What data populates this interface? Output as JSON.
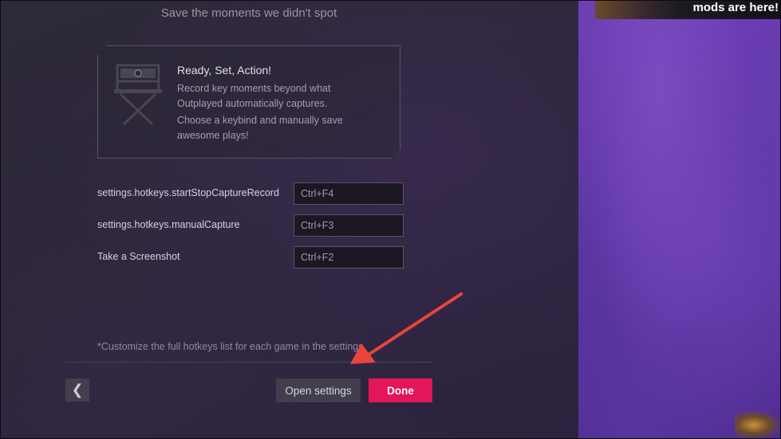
{
  "header": {
    "subtitle": "Save the moments we didn't spot"
  },
  "card": {
    "icon": "director-chair-icon",
    "title": "Ready, Set, Action!",
    "line1": "Record key moments beyond what",
    "line2": "Outplayed automatically captures.",
    "line3": "Choose a keybind and manually save",
    "line4": "awesome plays!"
  },
  "hotkeys": [
    {
      "label": "settings.hotkeys.startStopCaptureRecord",
      "value": "Ctrl+F4"
    },
    {
      "label": "settings.hotkeys.manualCapture",
      "value": "Ctrl+F3"
    },
    {
      "label": "Take a Screenshot",
      "value": "Ctrl+F2"
    }
  ],
  "footnote": "*Customize the full hotkeys list for each game in the settings",
  "footer": {
    "back_label": "❮",
    "open_settings_label": "Open settings",
    "done_label": "Done"
  },
  "promo": {
    "text": "mods are here!"
  },
  "colors": {
    "accent": "#e3165a",
    "annotation_arrow": "#e8453c",
    "side_panel": "#6a3db3"
  }
}
